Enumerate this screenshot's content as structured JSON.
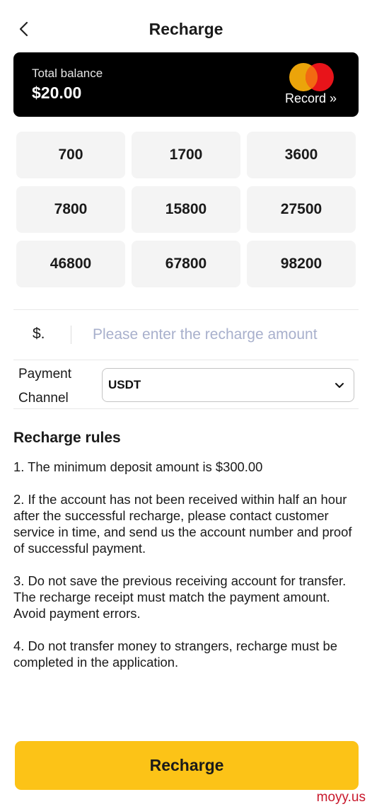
{
  "header": {
    "title": "Recharge",
    "back_icon": "chevron-left-icon"
  },
  "balance_card": {
    "label": "Total balance",
    "value": "$20.00",
    "record_label": "Record »",
    "logo_icon": "mastercard-logo",
    "colors": {
      "background": "#000000",
      "logo_left": "#eba40a",
      "logo_right": "#e8141a"
    }
  },
  "amounts": [
    "700",
    "1700",
    "3600",
    "7800",
    "15800",
    "27500",
    "46800",
    "67800",
    "98200"
  ],
  "amount_input": {
    "prefix": "$.",
    "placeholder": "Please enter the recharge amount"
  },
  "payment": {
    "label": "Payment Channel",
    "selected": "USDT",
    "dropdown_icon": "chevron-down-icon"
  },
  "rules": {
    "title": "Recharge rules",
    "items": [
      "1. The minimum deposit amount is $300.00",
      "2. If the account has not been received within half an hour after the successful recharge, please contact customer service in time, and send us the account number and proof of successful payment.",
      "3. Do not save the previous receiving account for transfer. The recharge receipt must match the payment amount. Avoid payment errors.",
      "4. Do not transfer money to strangers, recharge must be completed in the application."
    ]
  },
  "submit": {
    "label": "Recharge",
    "color": "#fcc317"
  },
  "watermark": "moyy.us"
}
